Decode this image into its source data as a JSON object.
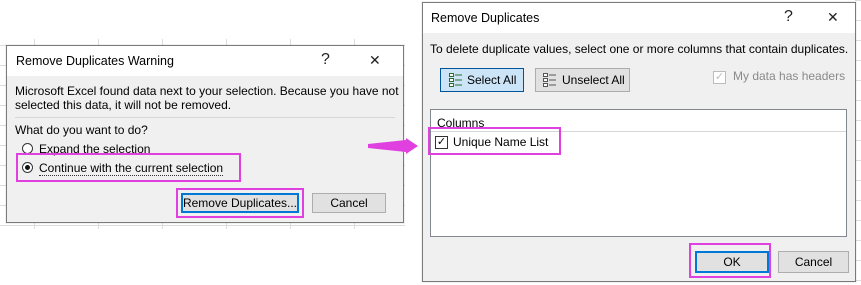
{
  "warning_dialog": {
    "title": "Remove Duplicates Warning",
    "help_glyph": "?",
    "close_glyph": "✕",
    "message_line1": "Microsoft Excel found data next to your selection. Because you have not",
    "message_line2": "selected this data, it will not be removed.",
    "question": "What do you want to do?",
    "options": [
      {
        "label": "Expand the selection",
        "selected": false
      },
      {
        "label": "Continue with the current selection",
        "selected": true
      }
    ],
    "remove_button": "Remove Duplicates...",
    "cancel_button": "Cancel"
  },
  "main_dialog": {
    "title": "Remove Duplicates",
    "help_glyph": "?",
    "close_glyph": "✕",
    "instruction": "To delete duplicate values, select one or more columns that contain duplicates.",
    "select_all_label": "Select All",
    "unselect_all_label": "Unselect All",
    "my_data_has_headers_label": "My data has headers",
    "my_data_has_headers_checked": true,
    "columns_header": "Columns",
    "columns": [
      {
        "label": "Unique Name List",
        "checked": true
      }
    ],
    "ok_button": "OK",
    "cancel_button": "Cancel"
  },
  "colors": {
    "highlight": "#e040e0",
    "focus_blue": "#0078d7"
  }
}
